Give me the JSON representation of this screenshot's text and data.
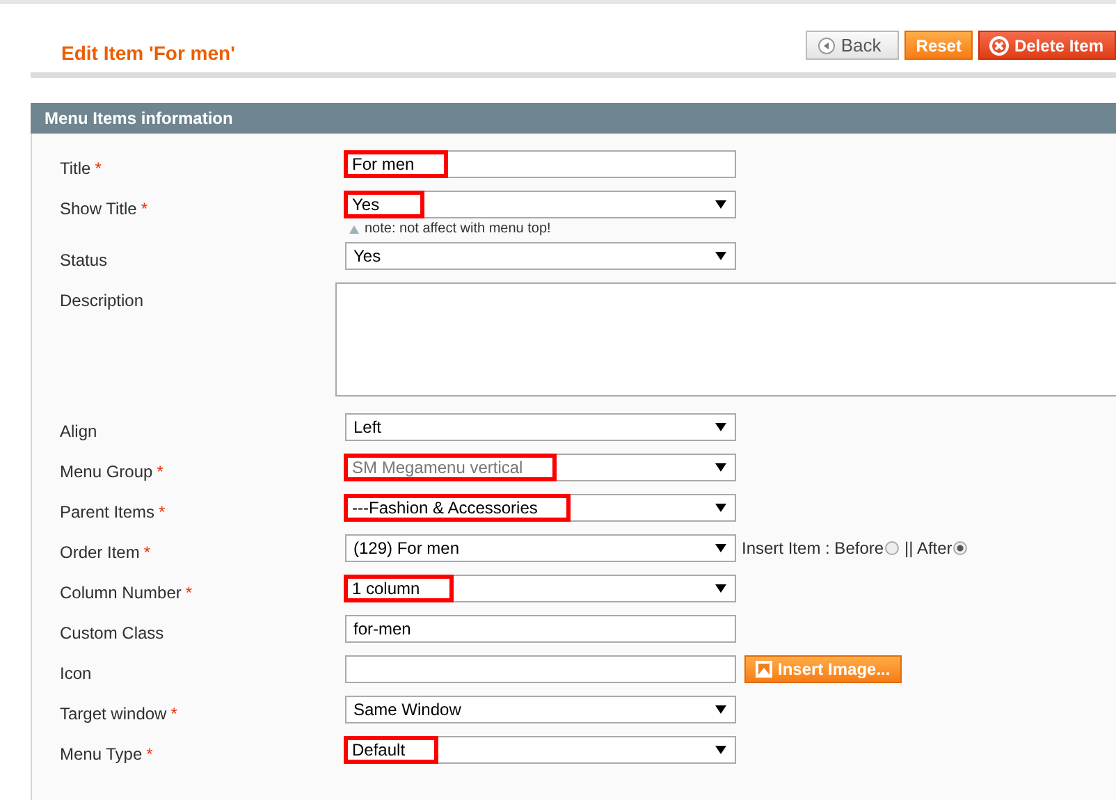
{
  "header": {
    "title": "Edit Item 'For men'",
    "buttons": [
      {
        "label": "Back",
        "kind": "back"
      },
      {
        "label": "Reset",
        "kind": "reset"
      },
      {
        "label": "Delete Item",
        "kind": "delete"
      }
    ]
  },
  "section": {
    "title": "Menu Items information"
  },
  "fields": [
    {
      "label": "Title",
      "required_mark": "*",
      "kind": "text",
      "value": "For men",
      "highlighted": true
    },
    {
      "label": "Show Title",
      "required_mark": "*",
      "kind": "select",
      "value": "Yes",
      "highlighted": true,
      "note": "note: not affect with menu top!"
    },
    {
      "label": "Status",
      "kind": "select",
      "value": "Yes",
      "highlighted": false
    },
    {
      "label": "Description",
      "kind": "textarea",
      "highlighted": false
    },
    {
      "label": "Align",
      "kind": "select",
      "value": "Left",
      "highlighted": false
    },
    {
      "label": "Menu Group",
      "required_mark": "*",
      "kind": "select",
      "value": "SM Megamenu vertical",
      "highlighted": true,
      "disabled": true
    },
    {
      "label": "Parent Items",
      "required_mark": "*",
      "kind": "select",
      "value": "---Fashion & Accessories",
      "highlighted": true
    },
    {
      "label": "Order Item",
      "required_mark": "*",
      "kind": "order",
      "value": "(129) For men",
      "highlighted": false,
      "insert_label": "Insert Item : Before",
      "separator": "|| After",
      "options": [
        {
          "selected": false
        },
        {
          "selected": true
        }
      ]
    },
    {
      "label": "Column Number",
      "required_mark": "*",
      "kind": "select",
      "value": "1 column",
      "highlighted": true
    },
    {
      "label": "Custom Class",
      "kind": "text",
      "value": "for-men",
      "highlighted": false
    },
    {
      "label": "Icon",
      "kind": "image",
      "highlighted": false,
      "button": "Insert Image..."
    },
    {
      "label": "Target window",
      "required_mark": "*",
      "kind": "select",
      "value": "Same Window",
      "highlighted": false
    },
    {
      "label": "Menu Type",
      "required_mark": "*",
      "kind": "select",
      "value": "Default",
      "highlighted": true
    }
  ]
}
